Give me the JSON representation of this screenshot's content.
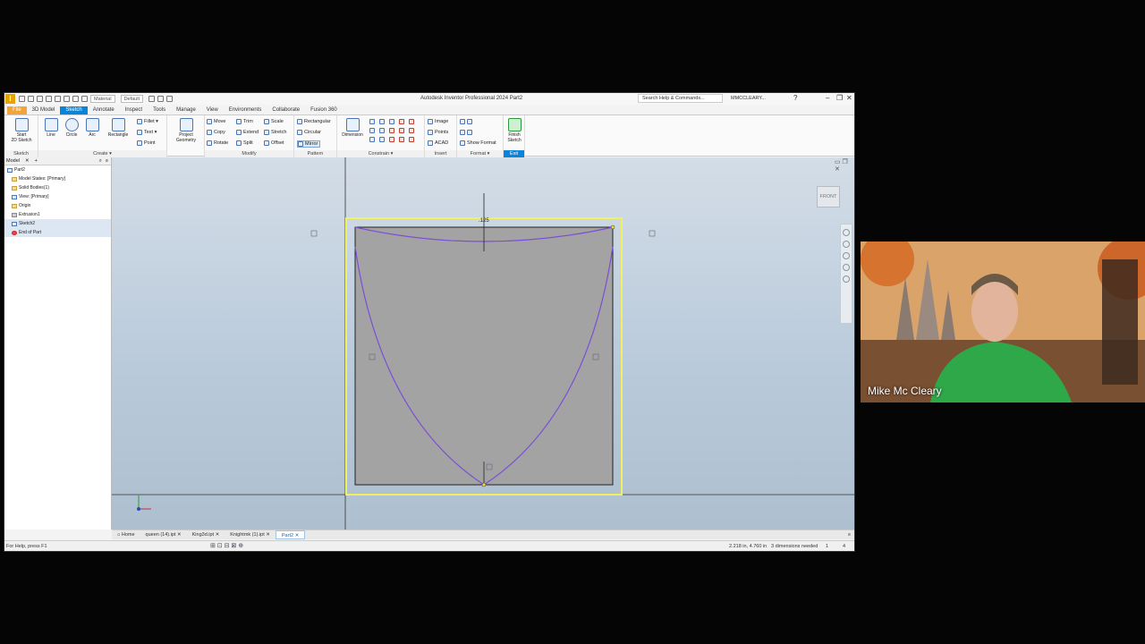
{
  "window": {
    "title": "Autodesk Inventor Professional 2024   Part2",
    "app_letter": "I",
    "material_dropdown": "Material",
    "appearance_dropdown": "Default",
    "search_placeholder": "Search Help & Commands...",
    "user": "MMCCLEARY..."
  },
  "ribbon_tabs": [
    "File",
    "3D Model",
    "Sketch",
    "Annotate",
    "Inspect",
    "Tools",
    "Manage",
    "View",
    "Environments",
    "Collaborate",
    "Fusion 360"
  ],
  "active_tab": "Sketch",
  "ribbon": {
    "sketch_panel": {
      "title": "Sketch",
      "start_line1": "Start",
      "start_line2": "2D Sketch"
    },
    "create_panel": {
      "title": "Create ▾",
      "line": "Line",
      "circle": "Circle",
      "arc": "Arc",
      "rectangle": "Rectangle",
      "fillet": "Fillet ▾",
      "text": "Text ▾",
      "point": "Point"
    },
    "project_geometry": {
      "line1": "Project",
      "line2": "Geometry"
    },
    "modify_panel": {
      "title": "Modify",
      "move": "Move",
      "trim": "Trim",
      "scale": "Scale",
      "copy": "Copy",
      "extend": "Extend",
      "stretch": "Stretch",
      "rotate": "Rotate",
      "split": "Split",
      "offset": "Offset"
    },
    "pattern_panel": {
      "title": "Pattern",
      "rectangular": "Rectangular",
      "circular": "Circular",
      "mirror": "Mirror"
    },
    "constrain_panel": {
      "title": "Constrain ▾",
      "dimension": "Dimension"
    },
    "insert_panel": {
      "title": "Insert",
      "image": "Image",
      "points": "Points",
      "acad": "ACAD"
    },
    "format_panel": {
      "title": "Format ▾",
      "show_format": "Show Format"
    },
    "exit_panel": {
      "title": "Exit",
      "finish_line1": "Finish",
      "finish_line2": "Sketch"
    }
  },
  "browser": {
    "tab_label": "Model",
    "items": [
      {
        "label": "Part2",
        "icon": "part-icon",
        "selected": false
      },
      {
        "label": "Model States: [Primary]",
        "icon": "folder-icon",
        "selected": false
      },
      {
        "label": "Solid Bodies(1)",
        "icon": "folder-icon",
        "selected": false
      },
      {
        "label": "View: [Primary]",
        "icon": "view-icon",
        "selected": false
      },
      {
        "label": "Origin",
        "icon": "folder-icon",
        "selected": false
      },
      {
        "label": "Extrusion1",
        "icon": "extrusion-icon",
        "selected": false
      },
      {
        "label": "Sketch2",
        "icon": "sketch-icon",
        "selected": true
      },
      {
        "label": "End of Part",
        "icon": "end-of-part-icon",
        "selected": true
      }
    ]
  },
  "canvas": {
    "dimension_label": ".125",
    "viewcube_face": "FRONT",
    "curve_color": "#7b4fd6",
    "selection_color": "#f0f060"
  },
  "doc_tabs": [
    "Home",
    "queen (14).ipt",
    "King3d.ipt",
    "Knightmk (1).ipt",
    "Part2"
  ],
  "active_doc": "Part2",
  "status": {
    "help": "For Help, press F1",
    "coords": "2.218 in, 4.760 in",
    "dimensions_needed": "3 dimensions needed",
    "count1": "1",
    "count2": "4"
  },
  "webcam": {
    "presenter_name": "Mike Mc Cleary"
  }
}
